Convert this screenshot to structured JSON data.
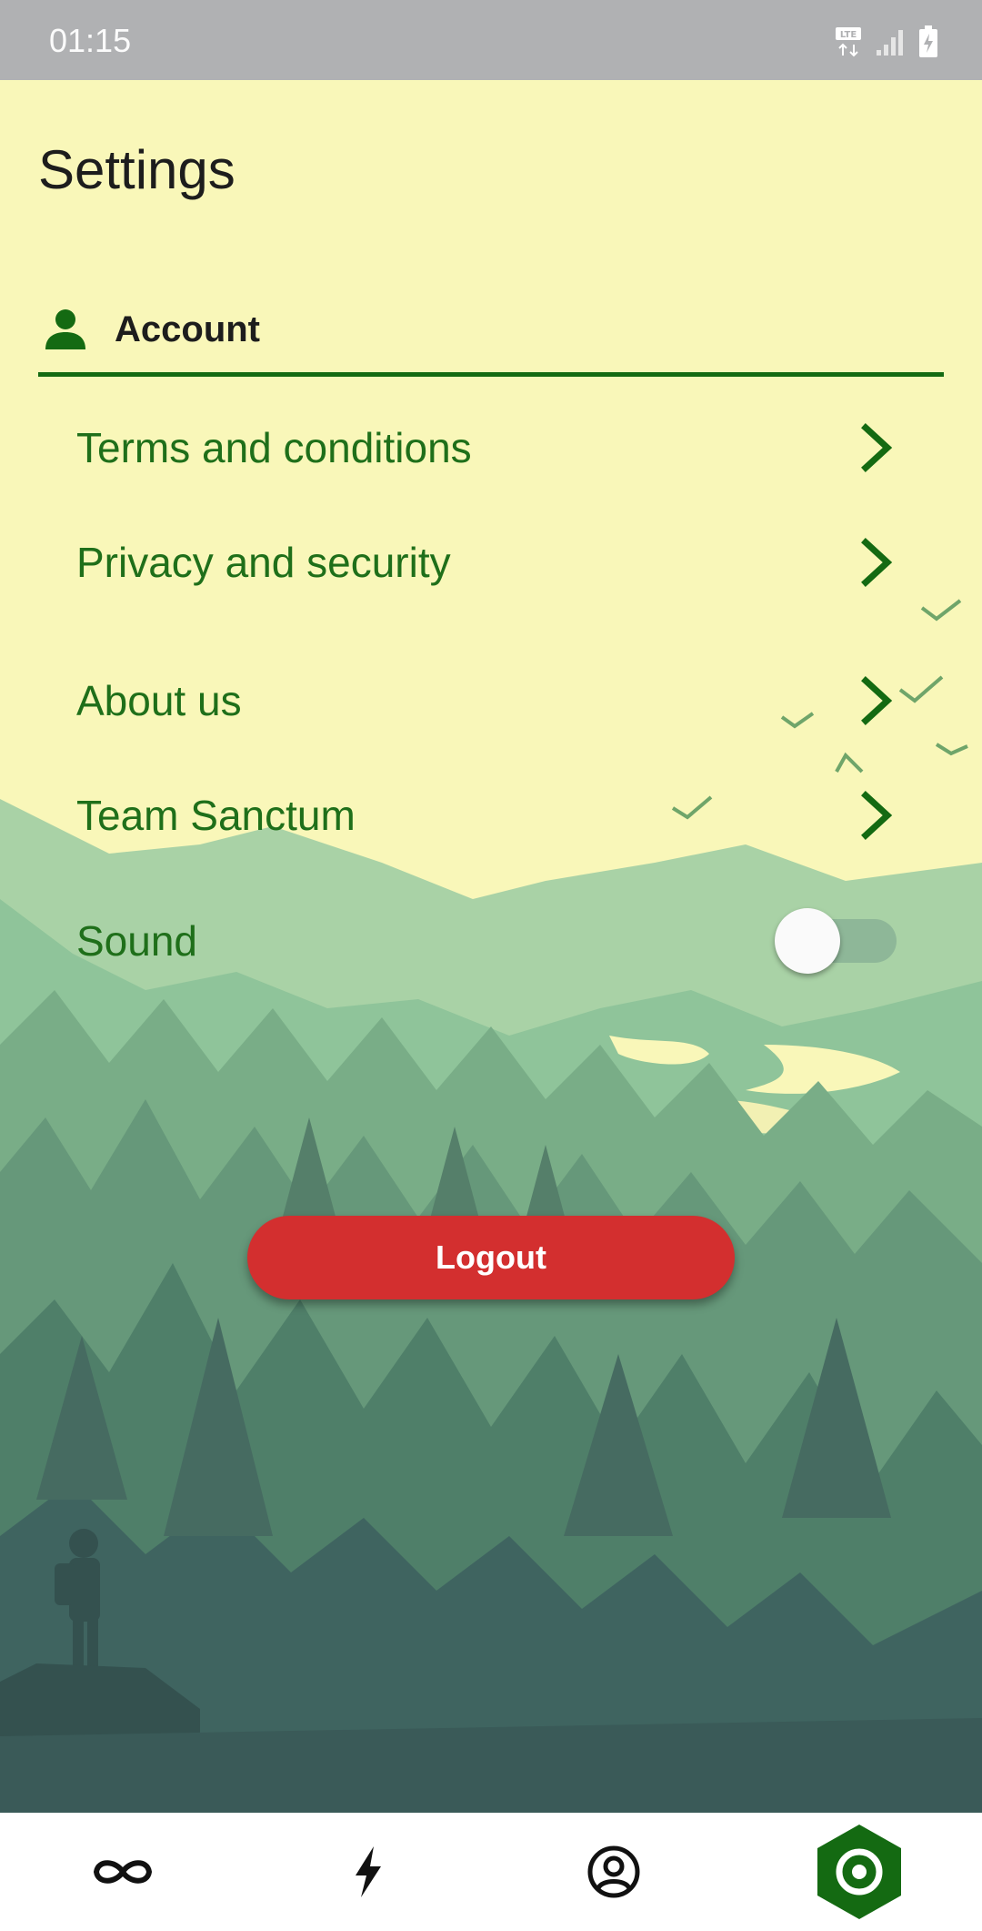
{
  "status_bar": {
    "time": "01:15",
    "icons": [
      "lte-icon",
      "signal-icon",
      "battery-charging-icon"
    ]
  },
  "header": {
    "title": "Settings"
  },
  "account_section": {
    "icon": "person-icon",
    "label": "Account"
  },
  "menu": {
    "items": [
      {
        "label": "Terms and conditions",
        "icon": "chevron-right-icon"
      },
      {
        "label": "Privacy and security",
        "icon": "chevron-right-icon"
      },
      {
        "label": "About us",
        "icon": "chevron-right-icon"
      },
      {
        "label": "Team Sanctum",
        "icon": "chevron-right-icon"
      }
    ]
  },
  "sound": {
    "label": "Sound",
    "enabled": false
  },
  "logout": {
    "label": "Logout"
  },
  "bottom_nav": {
    "items": [
      {
        "icon": "infinity-icon",
        "active": false
      },
      {
        "icon": "lightning-icon",
        "active": false
      },
      {
        "icon": "user-circle-icon",
        "active": false
      },
      {
        "icon": "settings-target-icon",
        "active": true
      }
    ]
  },
  "colors": {
    "accent_green": "#146a12",
    "text_green": "#1f6f1a",
    "logout_red": "#d32f2f",
    "sky": "#f9f7b9",
    "status_bar": "#b0b1b3"
  }
}
